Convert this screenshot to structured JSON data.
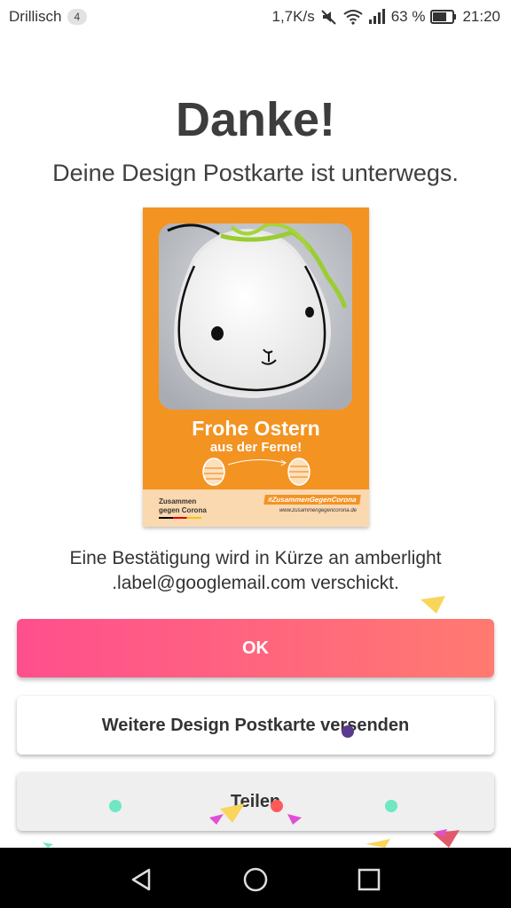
{
  "status_bar": {
    "carrier": "Drillisch",
    "carrier_badge": "4",
    "speed": "1,7K/s",
    "battery": "63 %",
    "time": "21:20",
    "icons": [
      "mute-icon",
      "wifi-icon",
      "signal-icon",
      "battery-icon"
    ]
  },
  "main": {
    "title": "Danke!",
    "subtitle": "Deine Design Postkarte ist unterwegs.",
    "postcard": {
      "headline": "Frohe Ostern",
      "subline": "aus der Ferne!",
      "footer_left_line1": "Zusammen",
      "footer_left_line2": "gegen Corona",
      "footer_hashtag": "#ZusammenGegenCorona",
      "footer_url": "www.zusammengegencorona.de",
      "colors": {
        "background": "#f39322",
        "footer": "#fad8b0"
      }
    },
    "confirmation_line1": "Eine Bestätigung wird in Kürze an amberlight",
    "confirmation_line2": ".label@googlemail.com verschickt."
  },
  "buttons": {
    "ok": "OK",
    "send_another": "Weitere Design Postkarte versenden",
    "share": "Teilen"
  },
  "navbar": {
    "icons": [
      "back-icon",
      "home-icon",
      "recents-icon"
    ]
  },
  "colors": {
    "ok_gradient_start": "#ff4f8e",
    "ok_gradient_end": "#ff7a70"
  }
}
